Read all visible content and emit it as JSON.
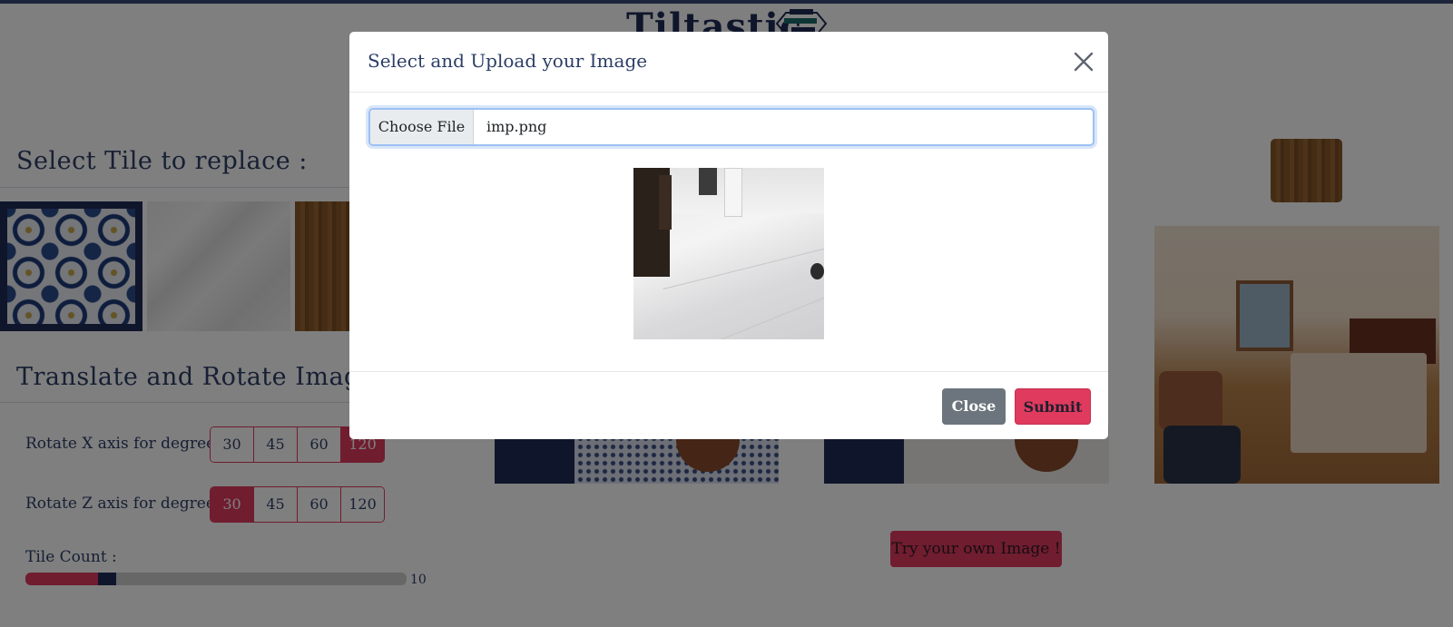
{
  "app": {
    "brand": "Tiltastic"
  },
  "sections": {
    "select_tile_title": "Select Tile to replace :",
    "translate_rotate_title": "Translate and Rotate Image"
  },
  "controls": {
    "rotate_x": {
      "label": "Rotate X axis for degrees :",
      "options": [
        "30",
        "45",
        "60",
        "120"
      ],
      "selected": "120"
    },
    "rotate_z": {
      "label": "Rotate Z axis for degrees :",
      "options": [
        "30",
        "45",
        "60",
        "120"
      ],
      "selected": "30"
    },
    "tile_count": {
      "label": "Tile Count :",
      "value": "10",
      "fill_fraction": 0.19
    }
  },
  "try_button": "Try your own Image !",
  "modal": {
    "title": "Select and Upload your Image",
    "close_icon": "close-icon",
    "file_button": "Choose File",
    "file_name": "imp.png",
    "close_button": "Close",
    "submit_button": "Submit"
  },
  "colors": {
    "accent": "#e03a5f",
    "navy": "#1f2d57",
    "backdrop": "rgba(0,0,0,0.5)"
  }
}
